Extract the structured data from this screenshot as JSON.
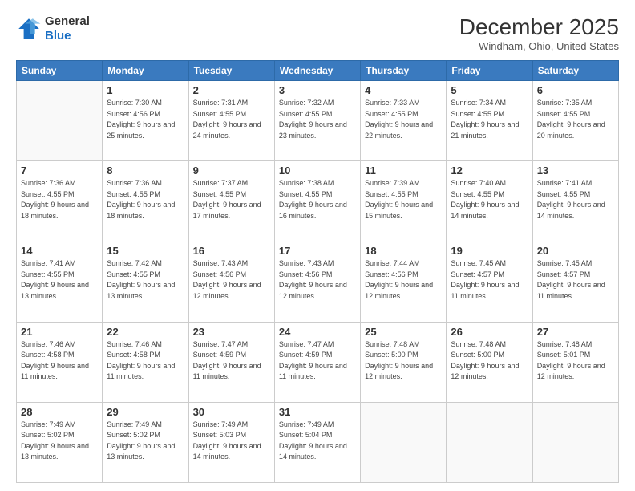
{
  "logo": {
    "general": "General",
    "blue": "Blue"
  },
  "header": {
    "month": "December 2025",
    "location": "Windham, Ohio, United States"
  },
  "days_of_week": [
    "Sunday",
    "Monday",
    "Tuesday",
    "Wednesday",
    "Thursday",
    "Friday",
    "Saturday"
  ],
  "weeks": [
    [
      {
        "day": "",
        "sunrise": "",
        "sunset": "",
        "daylight": ""
      },
      {
        "day": "1",
        "sunrise": "Sunrise: 7:30 AM",
        "sunset": "Sunset: 4:56 PM",
        "daylight": "Daylight: 9 hours and 25 minutes."
      },
      {
        "day": "2",
        "sunrise": "Sunrise: 7:31 AM",
        "sunset": "Sunset: 4:55 PM",
        "daylight": "Daylight: 9 hours and 24 minutes."
      },
      {
        "day": "3",
        "sunrise": "Sunrise: 7:32 AM",
        "sunset": "Sunset: 4:55 PM",
        "daylight": "Daylight: 9 hours and 23 minutes."
      },
      {
        "day": "4",
        "sunrise": "Sunrise: 7:33 AM",
        "sunset": "Sunset: 4:55 PM",
        "daylight": "Daylight: 9 hours and 22 minutes."
      },
      {
        "day": "5",
        "sunrise": "Sunrise: 7:34 AM",
        "sunset": "Sunset: 4:55 PM",
        "daylight": "Daylight: 9 hours and 21 minutes."
      },
      {
        "day": "6",
        "sunrise": "Sunrise: 7:35 AM",
        "sunset": "Sunset: 4:55 PM",
        "daylight": "Daylight: 9 hours and 20 minutes."
      }
    ],
    [
      {
        "day": "7",
        "sunrise": "Sunrise: 7:36 AM",
        "sunset": "Sunset: 4:55 PM",
        "daylight": "Daylight: 9 hours and 18 minutes."
      },
      {
        "day": "8",
        "sunrise": "Sunrise: 7:36 AM",
        "sunset": "Sunset: 4:55 PM",
        "daylight": "Daylight: 9 hours and 18 minutes."
      },
      {
        "day": "9",
        "sunrise": "Sunrise: 7:37 AM",
        "sunset": "Sunset: 4:55 PM",
        "daylight": "Daylight: 9 hours and 17 minutes."
      },
      {
        "day": "10",
        "sunrise": "Sunrise: 7:38 AM",
        "sunset": "Sunset: 4:55 PM",
        "daylight": "Daylight: 9 hours and 16 minutes."
      },
      {
        "day": "11",
        "sunrise": "Sunrise: 7:39 AM",
        "sunset": "Sunset: 4:55 PM",
        "daylight": "Daylight: 9 hours and 15 minutes."
      },
      {
        "day": "12",
        "sunrise": "Sunrise: 7:40 AM",
        "sunset": "Sunset: 4:55 PM",
        "daylight": "Daylight: 9 hours and 14 minutes."
      },
      {
        "day": "13",
        "sunrise": "Sunrise: 7:41 AM",
        "sunset": "Sunset: 4:55 PM",
        "daylight": "Daylight: 9 hours and 14 minutes."
      }
    ],
    [
      {
        "day": "14",
        "sunrise": "Sunrise: 7:41 AM",
        "sunset": "Sunset: 4:55 PM",
        "daylight": "Daylight: 9 hours and 13 minutes."
      },
      {
        "day": "15",
        "sunrise": "Sunrise: 7:42 AM",
        "sunset": "Sunset: 4:55 PM",
        "daylight": "Daylight: 9 hours and 13 minutes."
      },
      {
        "day": "16",
        "sunrise": "Sunrise: 7:43 AM",
        "sunset": "Sunset: 4:56 PM",
        "daylight": "Daylight: 9 hours and 12 minutes."
      },
      {
        "day": "17",
        "sunrise": "Sunrise: 7:43 AM",
        "sunset": "Sunset: 4:56 PM",
        "daylight": "Daylight: 9 hours and 12 minutes."
      },
      {
        "day": "18",
        "sunrise": "Sunrise: 7:44 AM",
        "sunset": "Sunset: 4:56 PM",
        "daylight": "Daylight: 9 hours and 12 minutes."
      },
      {
        "day": "19",
        "sunrise": "Sunrise: 7:45 AM",
        "sunset": "Sunset: 4:57 PM",
        "daylight": "Daylight: 9 hours and 11 minutes."
      },
      {
        "day": "20",
        "sunrise": "Sunrise: 7:45 AM",
        "sunset": "Sunset: 4:57 PM",
        "daylight": "Daylight: 9 hours and 11 minutes."
      }
    ],
    [
      {
        "day": "21",
        "sunrise": "Sunrise: 7:46 AM",
        "sunset": "Sunset: 4:58 PM",
        "daylight": "Daylight: 9 hours and 11 minutes."
      },
      {
        "day": "22",
        "sunrise": "Sunrise: 7:46 AM",
        "sunset": "Sunset: 4:58 PM",
        "daylight": "Daylight: 9 hours and 11 minutes."
      },
      {
        "day": "23",
        "sunrise": "Sunrise: 7:47 AM",
        "sunset": "Sunset: 4:59 PM",
        "daylight": "Daylight: 9 hours and 11 minutes."
      },
      {
        "day": "24",
        "sunrise": "Sunrise: 7:47 AM",
        "sunset": "Sunset: 4:59 PM",
        "daylight": "Daylight: 9 hours and 11 minutes."
      },
      {
        "day": "25",
        "sunrise": "Sunrise: 7:48 AM",
        "sunset": "Sunset: 5:00 PM",
        "daylight": "Daylight: 9 hours and 12 minutes."
      },
      {
        "day": "26",
        "sunrise": "Sunrise: 7:48 AM",
        "sunset": "Sunset: 5:00 PM",
        "daylight": "Daylight: 9 hours and 12 minutes."
      },
      {
        "day": "27",
        "sunrise": "Sunrise: 7:48 AM",
        "sunset": "Sunset: 5:01 PM",
        "daylight": "Daylight: 9 hours and 12 minutes."
      }
    ],
    [
      {
        "day": "28",
        "sunrise": "Sunrise: 7:49 AM",
        "sunset": "Sunset: 5:02 PM",
        "daylight": "Daylight: 9 hours and 13 minutes."
      },
      {
        "day": "29",
        "sunrise": "Sunrise: 7:49 AM",
        "sunset": "Sunset: 5:02 PM",
        "daylight": "Daylight: 9 hours and 13 minutes."
      },
      {
        "day": "30",
        "sunrise": "Sunrise: 7:49 AM",
        "sunset": "Sunset: 5:03 PM",
        "daylight": "Daylight: 9 hours and 14 minutes."
      },
      {
        "day": "31",
        "sunrise": "Sunrise: 7:49 AM",
        "sunset": "Sunset: 5:04 PM",
        "daylight": "Daylight: 9 hours and 14 minutes."
      },
      {
        "day": "",
        "sunrise": "",
        "sunset": "",
        "daylight": ""
      },
      {
        "day": "",
        "sunrise": "",
        "sunset": "",
        "daylight": ""
      },
      {
        "day": "",
        "sunrise": "",
        "sunset": "",
        "daylight": ""
      }
    ]
  ]
}
